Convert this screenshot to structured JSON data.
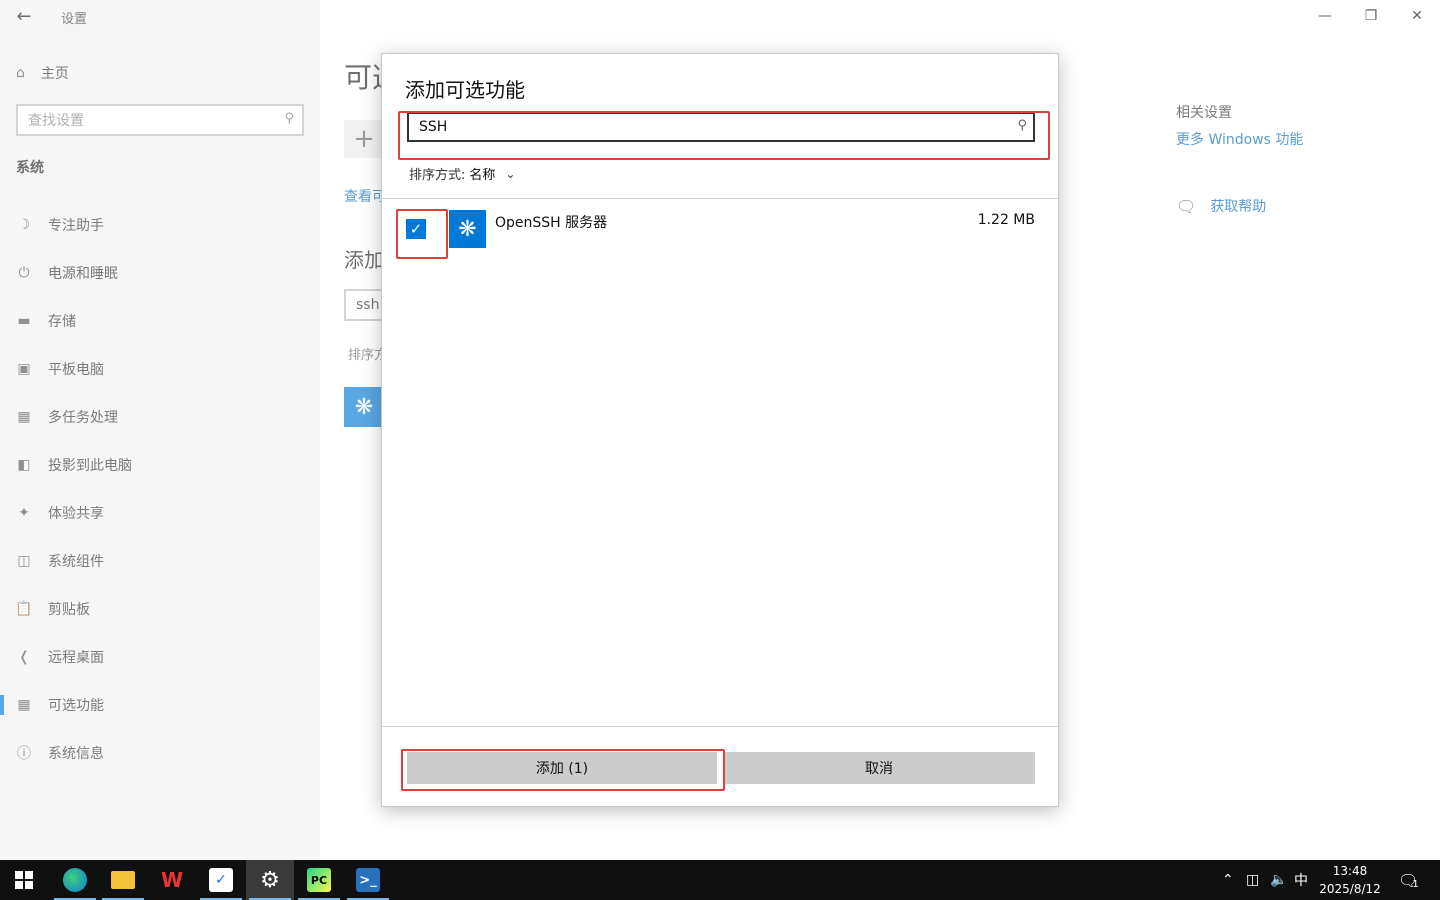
{
  "window": {
    "title": "设置",
    "back_icon": "arrow-left-icon",
    "controls": [
      "minimize",
      "restore",
      "close"
    ]
  },
  "sidebar": {
    "home_label": "主页",
    "search_placeholder": "查找设置",
    "section": "系统",
    "items": [
      {
        "label": "专注助手",
        "icon": "moon-icon"
      },
      {
        "label": "电源和睡眠",
        "icon": "power-icon"
      },
      {
        "label": "存储",
        "icon": "storage-icon"
      },
      {
        "label": "平板电脑",
        "icon": "tablet-icon"
      },
      {
        "label": "多任务处理",
        "icon": "multitask-icon"
      },
      {
        "label": "投影到此电脑",
        "icon": "project-icon"
      },
      {
        "label": "体验共享",
        "icon": "share-icon"
      },
      {
        "label": "系统组件",
        "icon": "components-icon"
      },
      {
        "label": "剪贴板",
        "icon": "clipboard-icon"
      },
      {
        "label": "远程桌面",
        "icon": "remote-desktop-icon"
      },
      {
        "label": "可选功能",
        "icon": "optional-features-icon",
        "active": true
      },
      {
        "label": "系统信息",
        "icon": "info-icon"
      }
    ]
  },
  "main": {
    "heading_partial": "可选",
    "link_partial": "查看可",
    "sub_heading_partial": "添加",
    "search_value_partial": "ssh",
    "sort_partial": "排序方",
    "related_title": "相关设置",
    "related_link": "更多 Windows 功能",
    "help_link": "获取帮助"
  },
  "dialog": {
    "title": "添加可选功能",
    "search_value": "SSH",
    "sort_label": "排序方式:",
    "sort_value": "名称",
    "features": [
      {
        "name": "OpenSSH 服务器",
        "size": "1.22 MB",
        "checked": true
      }
    ],
    "add_button": "添加 (1)",
    "cancel_button": "取消"
  },
  "taskbar": {
    "apps": [
      "start",
      "edge",
      "file-explorer",
      "wps",
      "kingsoft-docs",
      "settings",
      "pycharm",
      "powershell"
    ],
    "tray_ime": "中",
    "time": "13:48",
    "date": "2025/8/12",
    "notification_count": "1"
  },
  "colors": {
    "accent": "#0078d7",
    "highlight_red": "#e0403a",
    "taskbar": "#101010"
  }
}
